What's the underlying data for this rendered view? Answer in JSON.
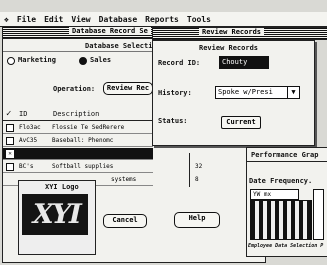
{
  "menubar": {
    "items": [
      "File",
      "Edit",
      "View",
      "Database",
      "Reports",
      "Tools"
    ]
  },
  "main_window": {
    "title": "Database Record Se",
    "selection_title": "Database Selectio",
    "options": [
      {
        "label": "Marketing",
        "selected": false
      },
      {
        "label": "Sales",
        "selected": true
      }
    ],
    "operation_label": "Operation:",
    "operation_button": "Review Rec",
    "columns": {
      "check": "✓",
      "id": "ID",
      "description": "Description"
    },
    "rows": [
      {
        "checked": false,
        "id": "Flo3ac",
        "description": "Flossie Te SedRerere",
        "qty": "",
        "highlighted": false
      },
      {
        "checked": false,
        "id": "AvC35",
        "description": "Baseball: Phenomc",
        "qty": "",
        "highlighted": false
      },
      {
        "checked": true,
        "id": "",
        "description": "",
        "qty": "",
        "highlighted": true
      },
      {
        "checked": false,
        "id": "BC's",
        "description": "Softball supplies",
        "qty": "32",
        "highlighted": false
      },
      {
        "checked": false,
        "id": "",
        "description": "systems",
        "qty": "8",
        "highlighted": false
      }
    ],
    "cancel_button": "Cancel",
    "help_button": "Help"
  },
  "logo_window": {
    "title": "XYI Logo",
    "logo_text": "XYI"
  },
  "review_window": {
    "title_bar": "Review Records",
    "heading": "Review Records",
    "record_id_label": "Record ID:",
    "record_id_value": "Chouty",
    "history_label": "History:",
    "history_value": "Spoke w/Presi",
    "status_label": "Status:",
    "status_value": "Current"
  },
  "perf_window": {
    "title": "Performance Grap",
    "date_label": "Date Frequency.",
    "select_value": "YW mx",
    "footer": "Employee Data Selection P"
  }
}
